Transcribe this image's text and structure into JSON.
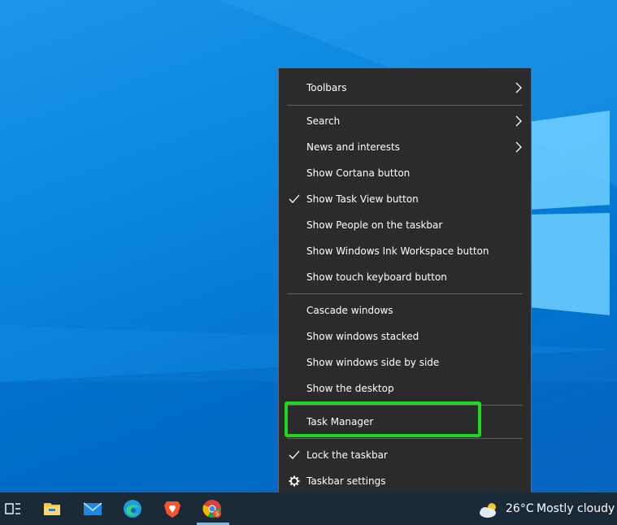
{
  "context_menu": {
    "items": [
      {
        "label": "Toolbars",
        "submenu": true,
        "checked": false
      },
      {
        "label": "Search",
        "submenu": true,
        "checked": false
      },
      {
        "label": "News and interests",
        "submenu": true,
        "checked": false
      },
      {
        "label": "Show Cortana button",
        "submenu": false,
        "checked": false
      },
      {
        "label": "Show Task View button",
        "submenu": false,
        "checked": true
      },
      {
        "label": "Show People on the taskbar",
        "submenu": false,
        "checked": false
      },
      {
        "label": "Show Windows Ink Workspace button",
        "submenu": false,
        "checked": false
      },
      {
        "label": "Show touch keyboard button",
        "submenu": false,
        "checked": false
      },
      {
        "label": "Cascade windows",
        "submenu": false,
        "checked": false
      },
      {
        "label": "Show windows stacked",
        "submenu": false,
        "checked": false
      },
      {
        "label": "Show windows side by side",
        "submenu": false,
        "checked": false
      },
      {
        "label": "Show the desktop",
        "submenu": false,
        "checked": false
      },
      {
        "label": "Task Manager",
        "submenu": false,
        "checked": false,
        "highlighted": true
      },
      {
        "label": "Lock the taskbar",
        "submenu": false,
        "checked": true
      },
      {
        "label": "Taskbar settings",
        "submenu": false,
        "checked": false,
        "icon": "gear-icon"
      }
    ]
  },
  "taskbar": {
    "icons": [
      "task-view-icon",
      "file-explorer-icon",
      "mail-icon",
      "edge-icon",
      "brave-icon",
      "chrome-icon"
    ],
    "active_icon": "chrome-icon",
    "chrome_badge": "S"
  },
  "weather": {
    "temperature": "26°C",
    "condition": "Mostly cloudy",
    "icon": "partly-cloudy-icon"
  },
  "colors": {
    "highlight_border": "#1fd71f",
    "menu_background": "#2b2b2b",
    "taskbar_background": "#1a2a37"
  }
}
